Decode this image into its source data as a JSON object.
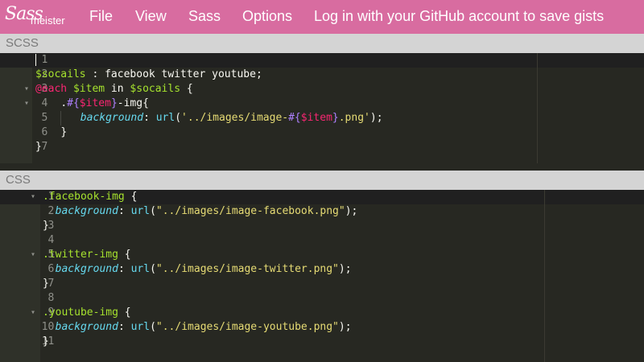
{
  "nav": {
    "logo_script": "Sass",
    "logo_word": "meister",
    "items": [
      "File",
      "View",
      "Sass",
      "Options",
      "Log in with your GitHub account to save gists"
    ]
  },
  "scss_pane": {
    "header": "SCSS",
    "lines": [
      {
        "n": "1",
        "fold": false
      },
      {
        "n": "2",
        "fold": false
      },
      {
        "n": "3",
        "fold": true
      },
      {
        "n": "4",
        "fold": true
      },
      {
        "n": "5",
        "fold": false
      },
      {
        "n": "6",
        "fold": false
      },
      {
        "n": "7",
        "fold": false
      }
    ],
    "code": {
      "l2": {
        "var": "$socails",
        "rest": " : facebook twitter youtube;"
      },
      "l3": {
        "kw": "@each",
        "sp": " ",
        "var": "$item",
        "in": " in ",
        "var2": "$socails",
        "brace": " {"
      },
      "l4": {
        "dot": ".",
        "hash": "#{",
        "var": "$item",
        "close": "}",
        "rest": "-img{"
      },
      "l5": {
        "prop": "background",
        "colon": ": ",
        "fn": "url",
        "open": "(",
        "str1": "'../images/image-",
        "interp_open": "#{",
        "var": "$item",
        "interp_close": "}",
        "str2": ".png'",
        "close": ");"
      },
      "l6": "}",
      "l7": "}"
    }
  },
  "css_pane": {
    "header": "CSS",
    "lines": [
      {
        "n": "1",
        "fold": true
      },
      {
        "n": "2",
        "fold": false
      },
      {
        "n": "3",
        "fold": false
      },
      {
        "n": "4",
        "fold": false
      },
      {
        "n": "5",
        "fold": true
      },
      {
        "n": "6",
        "fold": false
      },
      {
        "n": "7",
        "fold": false
      },
      {
        "n": "8",
        "fold": false
      },
      {
        "n": "9",
        "fold": true
      },
      {
        "n": "10",
        "fold": false
      },
      {
        "n": "11",
        "fold": false
      }
    ],
    "code": {
      "l1": {
        "sel": ".facebook-img",
        "brace": " {"
      },
      "l2": {
        "prop": "background",
        "colon": ": ",
        "fn": "url",
        "open": "(",
        "str": "\"../images/image-facebook.png\"",
        "close": ");"
      },
      "l3": "}",
      "l5": {
        "sel": ".twitter-img",
        "brace": " {"
      },
      "l6": {
        "prop": "background",
        "colon": ": ",
        "fn": "url",
        "open": "(",
        "str": "\"../images/image-twitter.png\"",
        "close": ");"
      },
      "l7": "}",
      "l9": {
        "sel": ".youtube-img",
        "brace": " {"
      },
      "l10": {
        "prop": "background",
        "colon": ": ",
        "fn": "url",
        "open": "(",
        "str": "\"../images/image-youtube.png\"",
        "close": ");"
      },
      "l11": "}"
    }
  },
  "colors": {
    "topbar": "#d86ca0",
    "editor_bg": "#272822",
    "gutter_bg": "#2f3129",
    "pane_header_bg": "#d4d4d4"
  }
}
